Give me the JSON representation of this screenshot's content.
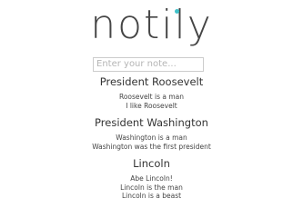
{
  "app": {
    "logo_text": "notily",
    "accent_color": "#3fc1c9"
  },
  "search": {
    "placeholder": "Enter your note...",
    "value": ""
  },
  "notes": [
    {
      "title": "President Roosevelt",
      "lines": [
        "Roosevelt is a man",
        "I like Roosevelt"
      ]
    },
    {
      "title": "President Washington",
      "lines": [
        "Washington is a man",
        "Washington was the first president"
      ]
    },
    {
      "title": "Lincoln",
      "lines": [
        "Abe Lincoln!",
        "Lincoln is the man",
        "Lincoln is a beast"
      ]
    }
  ]
}
